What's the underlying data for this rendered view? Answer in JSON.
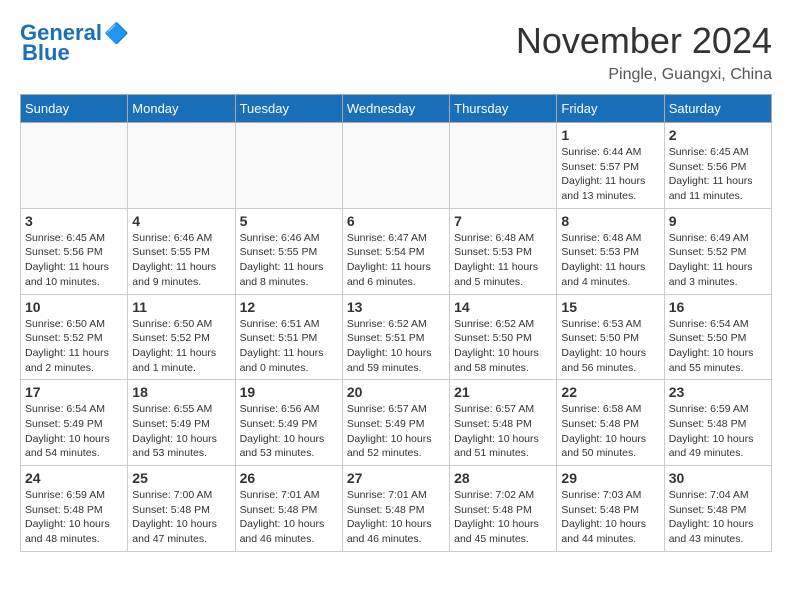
{
  "header": {
    "logo_line1": "General",
    "logo_line2": "Blue",
    "month_title": "November 2024",
    "location": "Pingle, Guangxi, China"
  },
  "weekdays": [
    "Sunday",
    "Monday",
    "Tuesday",
    "Wednesday",
    "Thursday",
    "Friday",
    "Saturday"
  ],
  "weeks": [
    [
      {
        "day": "",
        "info": ""
      },
      {
        "day": "",
        "info": ""
      },
      {
        "day": "",
        "info": ""
      },
      {
        "day": "",
        "info": ""
      },
      {
        "day": "",
        "info": ""
      },
      {
        "day": "1",
        "info": "Sunrise: 6:44 AM\nSunset: 5:57 PM\nDaylight: 11 hours and 13 minutes."
      },
      {
        "day": "2",
        "info": "Sunrise: 6:45 AM\nSunset: 5:56 PM\nDaylight: 11 hours and 11 minutes."
      }
    ],
    [
      {
        "day": "3",
        "info": "Sunrise: 6:45 AM\nSunset: 5:56 PM\nDaylight: 11 hours and 10 minutes."
      },
      {
        "day": "4",
        "info": "Sunrise: 6:46 AM\nSunset: 5:55 PM\nDaylight: 11 hours and 9 minutes."
      },
      {
        "day": "5",
        "info": "Sunrise: 6:46 AM\nSunset: 5:55 PM\nDaylight: 11 hours and 8 minutes."
      },
      {
        "day": "6",
        "info": "Sunrise: 6:47 AM\nSunset: 5:54 PM\nDaylight: 11 hours and 6 minutes."
      },
      {
        "day": "7",
        "info": "Sunrise: 6:48 AM\nSunset: 5:53 PM\nDaylight: 11 hours and 5 minutes."
      },
      {
        "day": "8",
        "info": "Sunrise: 6:48 AM\nSunset: 5:53 PM\nDaylight: 11 hours and 4 minutes."
      },
      {
        "day": "9",
        "info": "Sunrise: 6:49 AM\nSunset: 5:52 PM\nDaylight: 11 hours and 3 minutes."
      }
    ],
    [
      {
        "day": "10",
        "info": "Sunrise: 6:50 AM\nSunset: 5:52 PM\nDaylight: 11 hours and 2 minutes."
      },
      {
        "day": "11",
        "info": "Sunrise: 6:50 AM\nSunset: 5:52 PM\nDaylight: 11 hours and 1 minute."
      },
      {
        "day": "12",
        "info": "Sunrise: 6:51 AM\nSunset: 5:51 PM\nDaylight: 11 hours and 0 minutes."
      },
      {
        "day": "13",
        "info": "Sunrise: 6:52 AM\nSunset: 5:51 PM\nDaylight: 10 hours and 59 minutes."
      },
      {
        "day": "14",
        "info": "Sunrise: 6:52 AM\nSunset: 5:50 PM\nDaylight: 10 hours and 58 minutes."
      },
      {
        "day": "15",
        "info": "Sunrise: 6:53 AM\nSunset: 5:50 PM\nDaylight: 10 hours and 56 minutes."
      },
      {
        "day": "16",
        "info": "Sunrise: 6:54 AM\nSunset: 5:50 PM\nDaylight: 10 hours and 55 minutes."
      }
    ],
    [
      {
        "day": "17",
        "info": "Sunrise: 6:54 AM\nSunset: 5:49 PM\nDaylight: 10 hours and 54 minutes."
      },
      {
        "day": "18",
        "info": "Sunrise: 6:55 AM\nSunset: 5:49 PM\nDaylight: 10 hours and 53 minutes."
      },
      {
        "day": "19",
        "info": "Sunrise: 6:56 AM\nSunset: 5:49 PM\nDaylight: 10 hours and 53 minutes."
      },
      {
        "day": "20",
        "info": "Sunrise: 6:57 AM\nSunset: 5:49 PM\nDaylight: 10 hours and 52 minutes."
      },
      {
        "day": "21",
        "info": "Sunrise: 6:57 AM\nSunset: 5:48 PM\nDaylight: 10 hours and 51 minutes."
      },
      {
        "day": "22",
        "info": "Sunrise: 6:58 AM\nSunset: 5:48 PM\nDaylight: 10 hours and 50 minutes."
      },
      {
        "day": "23",
        "info": "Sunrise: 6:59 AM\nSunset: 5:48 PM\nDaylight: 10 hours and 49 minutes."
      }
    ],
    [
      {
        "day": "24",
        "info": "Sunrise: 6:59 AM\nSunset: 5:48 PM\nDaylight: 10 hours and 48 minutes."
      },
      {
        "day": "25",
        "info": "Sunrise: 7:00 AM\nSunset: 5:48 PM\nDaylight: 10 hours and 47 minutes."
      },
      {
        "day": "26",
        "info": "Sunrise: 7:01 AM\nSunset: 5:48 PM\nDaylight: 10 hours and 46 minutes."
      },
      {
        "day": "27",
        "info": "Sunrise: 7:01 AM\nSunset: 5:48 PM\nDaylight: 10 hours and 46 minutes."
      },
      {
        "day": "28",
        "info": "Sunrise: 7:02 AM\nSunset: 5:48 PM\nDaylight: 10 hours and 45 minutes."
      },
      {
        "day": "29",
        "info": "Sunrise: 7:03 AM\nSunset: 5:48 PM\nDaylight: 10 hours and 44 minutes."
      },
      {
        "day": "30",
        "info": "Sunrise: 7:04 AM\nSunset: 5:48 PM\nDaylight: 10 hours and 43 minutes."
      }
    ]
  ]
}
